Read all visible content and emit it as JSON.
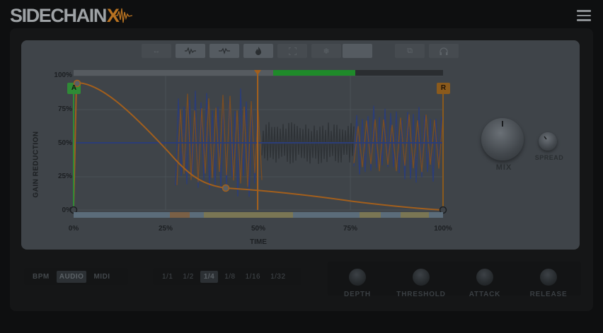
{
  "header": {
    "logo_text": "SIDECHAIN",
    "logo_accent": "X",
    "menu_icon": "hamburger-menu-icon"
  },
  "toolbar": {
    "buttons": [
      {
        "name": "collapse-icon",
        "glyph": "↔",
        "active": false
      },
      {
        "name": "waveform-icon",
        "glyph": "∿",
        "active": true
      },
      {
        "name": "waveform-alt-icon",
        "glyph": "∿",
        "active": true
      },
      {
        "name": "flame-icon",
        "glyph": "♨",
        "active": true
      },
      {
        "name": "fullscreen-icon",
        "glyph": "⛶",
        "active": false
      },
      {
        "name": "snowflake-icon",
        "glyph": "❄",
        "active": false
      },
      {
        "name": "blank-tool",
        "glyph": "",
        "active": true
      },
      {
        "name": "copy-icon",
        "glyph": "⧉",
        "active": false
      },
      {
        "name": "headphones-icon",
        "glyph": "🎧",
        "active": false
      }
    ]
  },
  "graph": {
    "y_axis_title": "GAIN REDUCTION",
    "x_axis_title": "TIME",
    "y_ticks": [
      "100%",
      "75%",
      "50%",
      "25%",
      "0%"
    ],
    "x_ticks": [
      "0%",
      "25%",
      "50%",
      "75%",
      "100%"
    ],
    "marker_a": "A",
    "marker_r": "R",
    "colors": {
      "curve": "#a35f1c",
      "wave_blue": "#2b3d78",
      "wave_orange": "#7a4d22",
      "marker_a": "#3b8a3f",
      "marker_r": "#8a5a1c",
      "progress_green": "#1f8a2a"
    }
  },
  "knobs": {
    "mix_label": "MIX",
    "spread_label": "SPREAD"
  },
  "bottom": {
    "modes": [
      {
        "label": "BPM",
        "active": false
      },
      {
        "label": "AUDIO",
        "active": true
      },
      {
        "label": "MIDI",
        "active": false
      }
    ],
    "divisions": [
      {
        "label": "1/1",
        "active": false
      },
      {
        "label": "1/2",
        "active": false
      },
      {
        "label": "1/4",
        "active": true
      },
      {
        "label": "1/8",
        "active": false
      },
      {
        "label": "1/16",
        "active": false
      },
      {
        "label": "1/32",
        "active": false
      }
    ],
    "knob_labels": [
      "DEPTH",
      "THRESHOLD",
      "ATTACK",
      "RELEASE"
    ]
  }
}
